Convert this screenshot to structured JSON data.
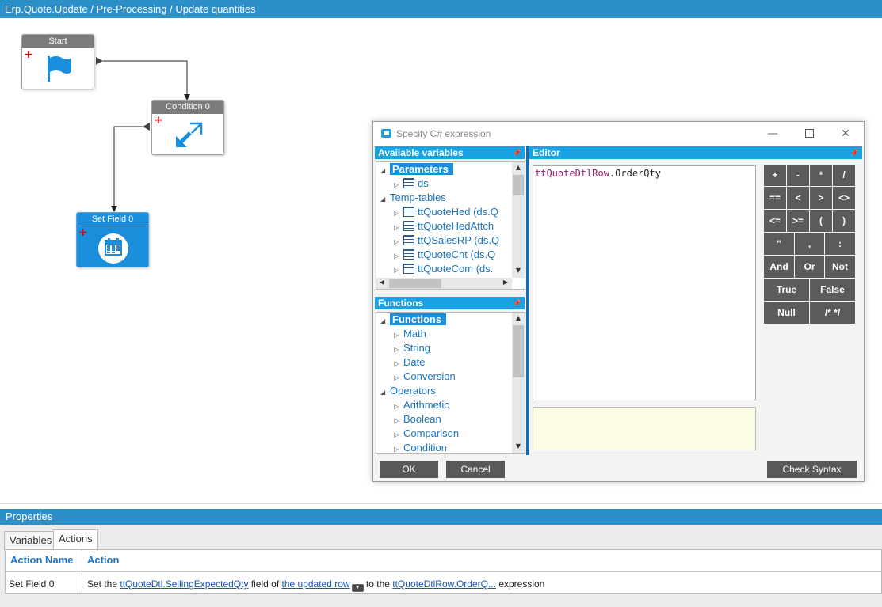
{
  "window": {
    "title": "Erp.Quote.Update / Pre-Processing / Update quantities"
  },
  "workflow": {
    "nodes": [
      {
        "label": "Start",
        "icon": "flag-icon"
      },
      {
        "label": "Condition 0",
        "icon": "condition-arrows-icon"
      },
      {
        "label": "Set Field 0",
        "icon": "calendar-icon"
      }
    ]
  },
  "dialog": {
    "title": "Specify C# expression",
    "variables_panel": {
      "title": "Available variables",
      "parameters_label": "Parameters",
      "parameters": [
        "ds"
      ],
      "temp_tables_label": "Temp-tables",
      "temp_tables": [
        "ttQuoteHed (ds.Q",
        "ttQuoteHedAttch",
        "ttQSalesRP (ds.Q",
        "ttQuoteCnt (ds.Q",
        "ttQuoteCom (ds."
      ]
    },
    "functions_panel": {
      "title": "Functions",
      "functions_label": "Functions",
      "functions": [
        "Math",
        "String",
        "Date",
        "Conversion"
      ],
      "operators_label": "Operators",
      "operators": [
        "Arithmetic",
        "Boolean",
        "Comparison",
        "Condition"
      ]
    },
    "editor": {
      "title": "Editor",
      "expr_object": "ttQuoteDtlRow",
      "expr_member": ".OrderQty"
    },
    "keypad": {
      "row1": [
        "+",
        "-",
        "*",
        "/"
      ],
      "row2": [
        "==",
        "<",
        ">",
        "<>"
      ],
      "row3": [
        "<=",
        ">=",
        "(",
        ")"
      ],
      "row4": [
        "\"",
        ",",
        ":"
      ],
      "row5": [
        "And",
        "Or",
        "Not"
      ],
      "row6": [
        "True",
        "False"
      ],
      "row7": [
        "Null",
        "/* */"
      ]
    },
    "ok_label": "OK",
    "cancel_label": "Cancel",
    "check_syntax_label": "Check Syntax"
  },
  "properties": {
    "title": "Properties",
    "tabs": [
      "Variables",
      "Actions"
    ],
    "active_tab": "Actions",
    "columns": [
      "Action Name",
      "Action"
    ],
    "row": {
      "name": "Set Field 0",
      "text_1": "Set the ",
      "link_field": "ttQuoteDtl.SellingExpectedQty",
      "text_2": " field of ",
      "link_row": "the updated row",
      "text_3": " to the ",
      "link_expr": "ttQuoteDtlRow.OrderQ...",
      "text_4": " expression"
    }
  },
  "colors": {
    "accent": "#1aa1e1",
    "header_blue": "#2d8fc7",
    "button_gray": "#595959",
    "node_header_gray": "#7b7b7b",
    "selected_node": "#1a8ddb"
  }
}
